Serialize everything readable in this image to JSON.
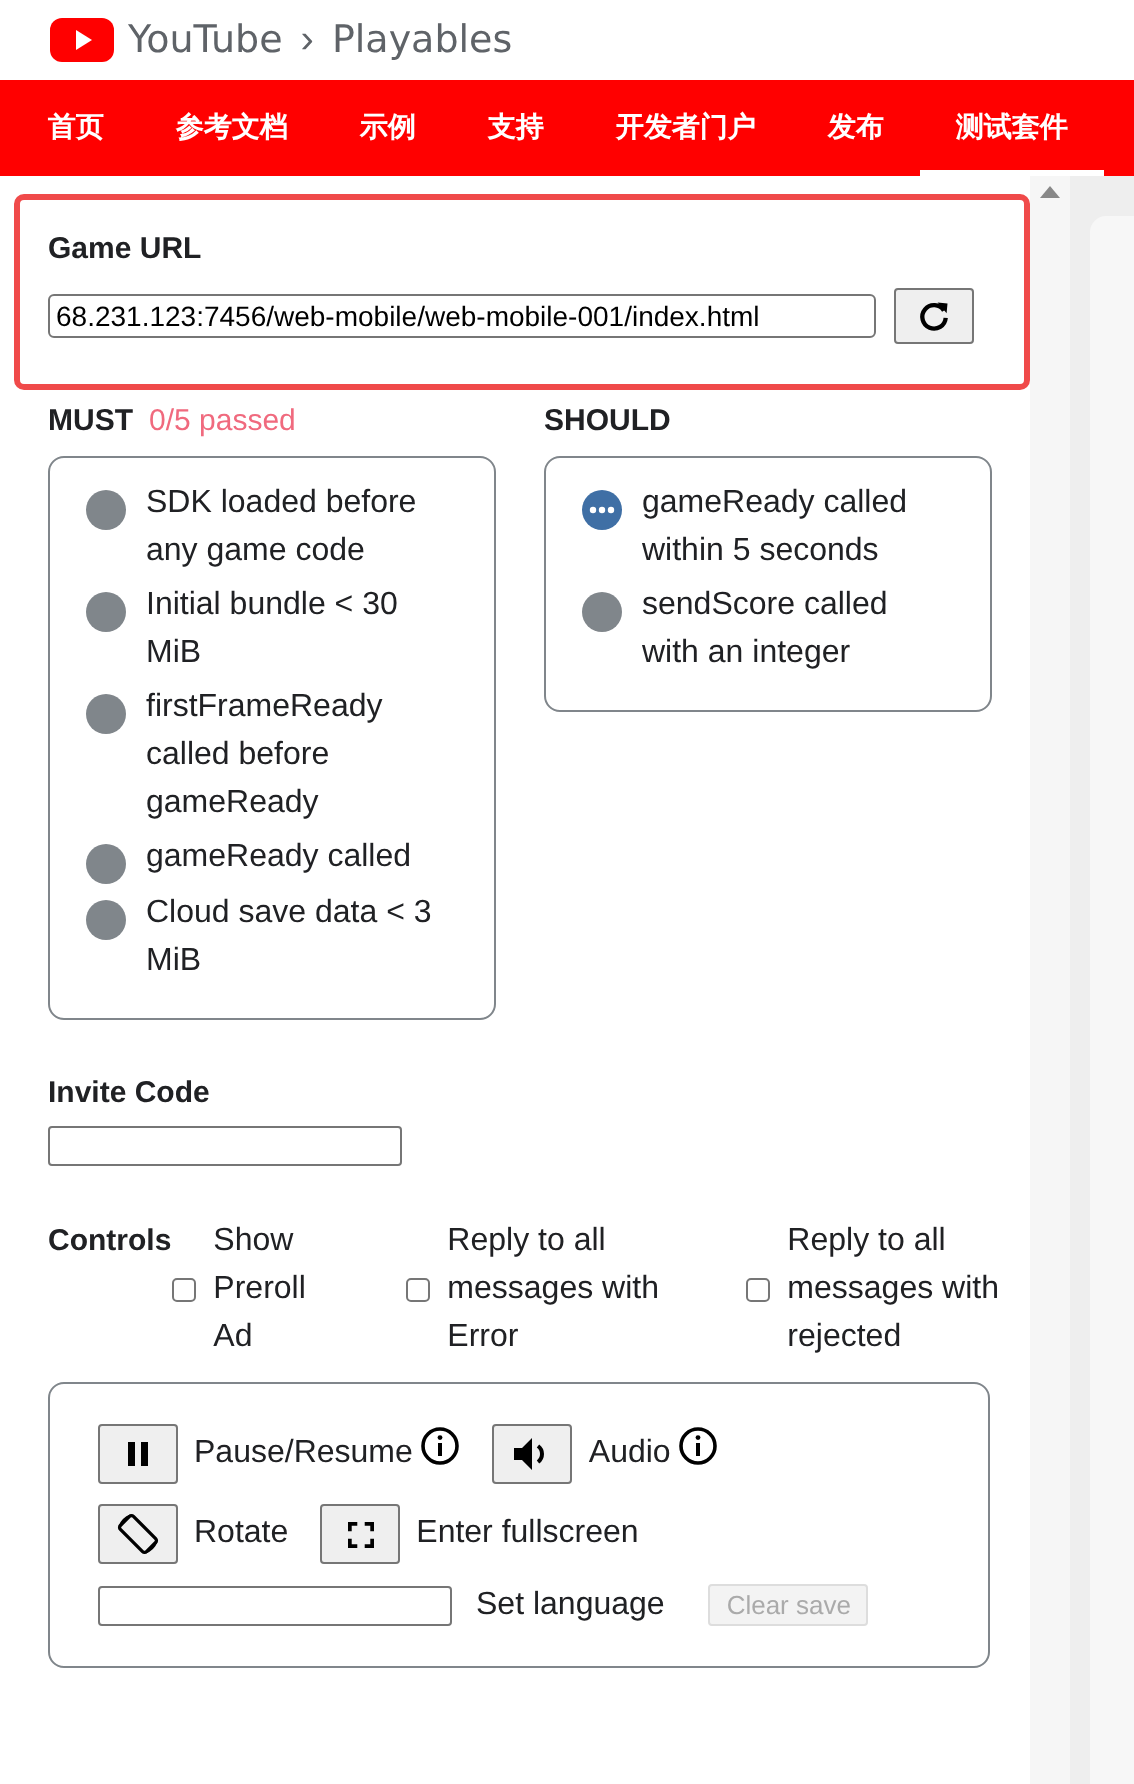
{
  "header": {
    "brand": "YouTube",
    "separator": "›",
    "product": "Playables"
  },
  "nav": [
    {
      "label": "首页",
      "selected": false
    },
    {
      "label": "参考文档",
      "selected": false
    },
    {
      "label": "示例",
      "selected": false
    },
    {
      "label": "支持",
      "selected": false
    },
    {
      "label": "开发者门户",
      "selected": false
    },
    {
      "label": "发布",
      "selected": false
    },
    {
      "label": "测试套件",
      "selected": true
    }
  ],
  "game_url": {
    "label": "Game URL",
    "value": "68.231.123:7456/web-mobile/web-mobile-001/index.html"
  },
  "must": {
    "title": "MUST",
    "summary": "0/5 passed",
    "checks": [
      {
        "label": "SDK loaded before any game code",
        "kind": "pending"
      },
      {
        "label": "Initial bundle < 30 MiB",
        "kind": "pending"
      },
      {
        "label": "firstFrameReady called before gameReady",
        "kind": "pending"
      },
      {
        "label": "gameReady called",
        "kind": "pending"
      },
      {
        "label": "Cloud save data < 3 MiB",
        "kind": "pending"
      }
    ]
  },
  "should": {
    "title": "SHOULD",
    "checks": [
      {
        "label": "gameReady called within 5 seconds",
        "kind": "running"
      },
      {
        "label": "sendScore called with an integer",
        "kind": "pending"
      }
    ]
  },
  "invite_code": {
    "label": "Invite Code"
  },
  "controls": {
    "title": "Controls",
    "options": [
      {
        "label": "Show Preroll Ad",
        "checked": false
      },
      {
        "label": "Reply to all messages with Error",
        "checked": false
      },
      {
        "label": "Reply to all messages with rejected",
        "checked": false
      }
    ],
    "rows": [
      [
        {
          "kind": "pause",
          "label": "Pause/Resume",
          "info": true
        },
        {
          "kind": "audio",
          "label": "Audio",
          "info": true
        }
      ],
      [
        {
          "kind": "rotate",
          "label": "Rotate",
          "info": false
        },
        {
          "kind": "fullscreen",
          "label": "Enter fullscreen",
          "info": false
        }
      ]
    ],
    "language_label": "Set language",
    "clear_button": {
      "label": "Clear save",
      "disabled": true
    }
  }
}
